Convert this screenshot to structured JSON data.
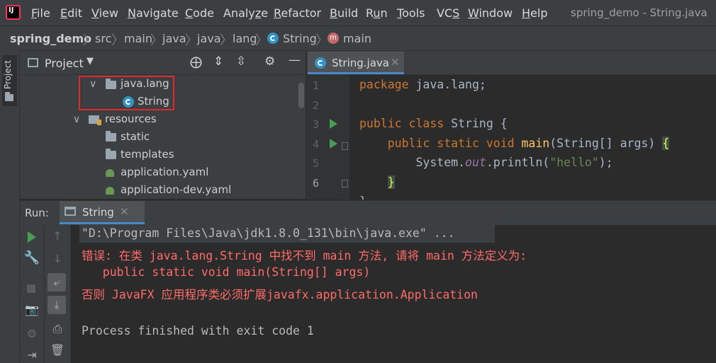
{
  "app": {
    "window_title": "spring_demo - String.java"
  },
  "menu": [
    {
      "pre": "",
      "u": "F",
      "post": "ile"
    },
    {
      "pre": "",
      "u": "E",
      "post": "dit"
    },
    {
      "pre": "",
      "u": "V",
      "post": "iew"
    },
    {
      "pre": "",
      "u": "N",
      "post": "avigate"
    },
    {
      "pre": "",
      "u": "C",
      "post": "ode"
    },
    {
      "pre": "Analy",
      "u": "z",
      "post": "e"
    },
    {
      "pre": "",
      "u": "R",
      "post": "efactor"
    },
    {
      "pre": "",
      "u": "B",
      "post": "uild"
    },
    {
      "pre": "R",
      "u": "u",
      "post": "n"
    },
    {
      "pre": "",
      "u": "T",
      "post": "ools"
    },
    {
      "pre": "VC",
      "u": "S",
      "post": ""
    },
    {
      "pre": "",
      "u": "W",
      "post": "indow"
    },
    {
      "pre": "",
      "u": "H",
      "post": "elp"
    }
  ],
  "breadcrumb": [
    "spring_demo",
    "src",
    "main",
    "java",
    "java",
    "lang",
    "String",
    "main"
  ],
  "project_panel": {
    "stripe_label": "Project",
    "title": "Project",
    "tree": [
      {
        "label": "java.lang",
        "icon": "package-folder-icon",
        "expanded": true
      },
      {
        "label": "String",
        "icon": "class-icon"
      },
      {
        "label": "resources",
        "icon": "resources-folder-icon",
        "expanded": true
      },
      {
        "label": "static",
        "icon": "folder-icon"
      },
      {
        "label": "templates",
        "icon": "folder-icon"
      },
      {
        "label": "application.yaml",
        "icon": "spring-yaml-icon"
      },
      {
        "label": "application-dev.yaml",
        "icon": "spring-yaml-icon"
      }
    ]
  },
  "editor": {
    "tab_label": "String.java",
    "line_numbers": [
      "1",
      "2",
      "3",
      "4",
      "5",
      "6"
    ],
    "current_line": "6"
  },
  "run_panel": {
    "label": "Run:",
    "tab_label": "String",
    "console": {
      "line1": "\"D:\\Program Files\\Java\\jdk1.8.0_131\\bin\\java.exe\" ...",
      "line2": "错误: 在类 java.lang.String 中找不到 main 方法, 请将 main 方法定义为:",
      "line3": "   public static void main(String[] args)",
      "line4": "否则 JavaFX 应用程序类必须扩展javafx.application.Application",
      "line5": "",
      "line6": "Process finished with exit code 1"
    }
  },
  "colors": {
    "keyword": "#cc7832",
    "function": "#ffc66d",
    "string": "#6a8759",
    "error_text": "#ff6b68",
    "highlight_box": "#e0282e"
  }
}
